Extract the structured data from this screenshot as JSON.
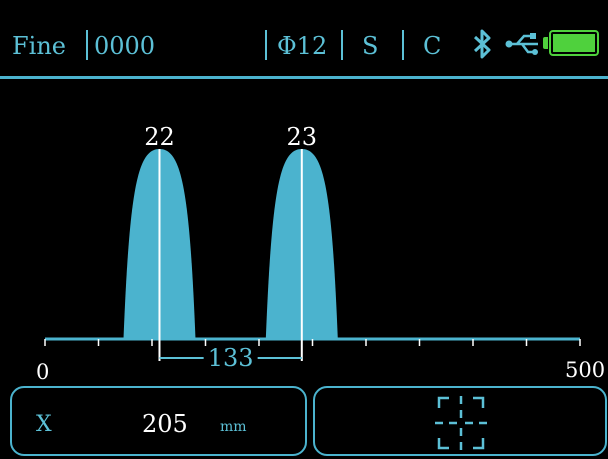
{
  "header": {
    "mode": "Fine",
    "counter": "0000",
    "diameter": "Φ12",
    "s_label": "S",
    "c_label": "C",
    "icons": [
      "bluetooth-icon",
      "usb-icon",
      "battery-icon"
    ],
    "battery_level": 1.0
  },
  "colors": {
    "accent": "#5cc0d6",
    "peak": "#4bb3ce",
    "battery": "#4fd13d",
    "background": "#000000"
  },
  "chart_data": {
    "type": "area",
    "xlim": [
      0,
      500
    ],
    "x_ticks": [
      "0",
      "500"
    ],
    "peaks": [
      {
        "label": "22",
        "x": 107
      },
      {
        "label": "23",
        "x": 240
      }
    ],
    "spacing": "133"
  },
  "controls": {
    "axis_label": "X",
    "value": "205",
    "unit": "mm",
    "target_icon": "crosshair-icon"
  }
}
